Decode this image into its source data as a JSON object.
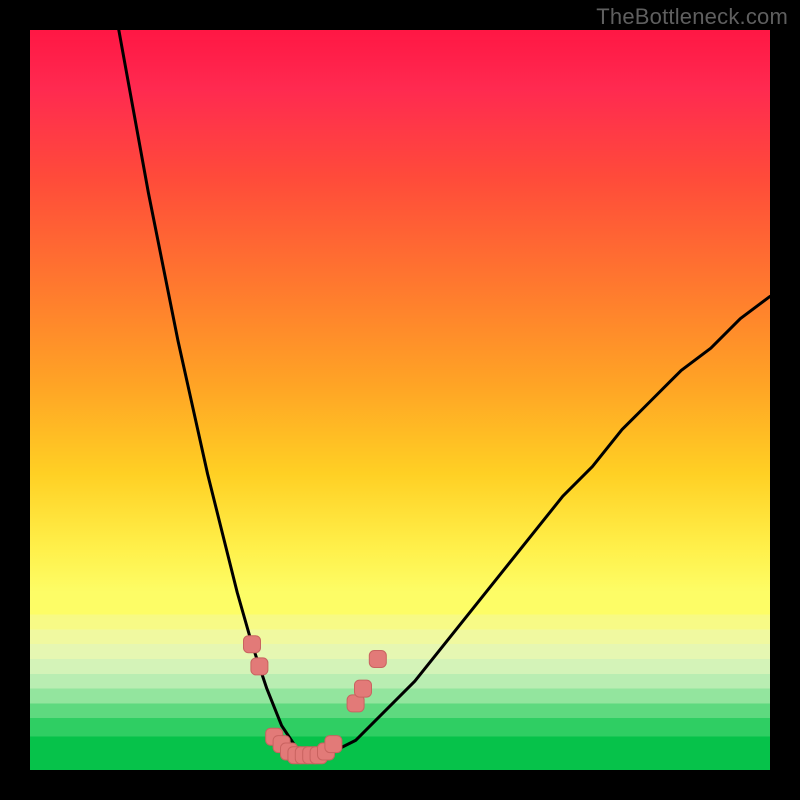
{
  "watermark": "TheBottleneck.com",
  "colors": {
    "frame": "#000000",
    "curve": "#000000",
    "marker_fill": "#e27a78",
    "marker_stroke": "#c96360",
    "gradient_top": "#ff1744",
    "gradient_mid": "#fff04a",
    "gradient_bottom": "#06c24a"
  },
  "chart_data": {
    "type": "line",
    "title": "",
    "xlabel": "",
    "ylabel": "",
    "xlim": [
      0,
      100
    ],
    "ylim": [
      0,
      100
    ],
    "grid": false,
    "legend": false,
    "description": "Single V-shaped bottleneck curve. Y represents bottleneck percentage (high = bad / red, low = good / green). X is an unlabeled parameter axis. The curve drops steeply from ~100 at x≈12 to ~2 near x≈33–40, then rises with a gentler slope toward ~64 at x=100.",
    "series": [
      {
        "name": "bottleneck-curve",
        "x": [
          12,
          14,
          16,
          18,
          20,
          22,
          24,
          26,
          28,
          30,
          32,
          34,
          36,
          38,
          40,
          44,
          48,
          52,
          56,
          60,
          64,
          68,
          72,
          76,
          80,
          84,
          88,
          92,
          96,
          100
        ],
        "y": [
          100,
          89,
          78,
          68,
          58,
          49,
          40,
          32,
          24,
          17,
          11,
          6,
          3,
          2,
          2,
          4,
          8,
          12,
          17,
          22,
          27,
          32,
          37,
          41,
          46,
          50,
          54,
          57,
          61,
          64
        ]
      }
    ],
    "markers": {
      "description": "Highlighted data points near the curve minimum, rendered as salmon rounded-square markers along the curve where it passes through the pale-yellow band.",
      "points": [
        {
          "x": 30,
          "y": 17
        },
        {
          "x": 31,
          "y": 14
        },
        {
          "x": 33,
          "y": 4.5
        },
        {
          "x": 34,
          "y": 3.5
        },
        {
          "x": 35,
          "y": 2.5
        },
        {
          "x": 36,
          "y": 2
        },
        {
          "x": 37,
          "y": 2
        },
        {
          "x": 38,
          "y": 2
        },
        {
          "x": 39,
          "y": 2
        },
        {
          "x": 40,
          "y": 2.5
        },
        {
          "x": 41,
          "y": 3.5
        },
        {
          "x": 44,
          "y": 9
        },
        {
          "x": 45,
          "y": 11
        },
        {
          "x": 47,
          "y": 15
        }
      ]
    }
  }
}
